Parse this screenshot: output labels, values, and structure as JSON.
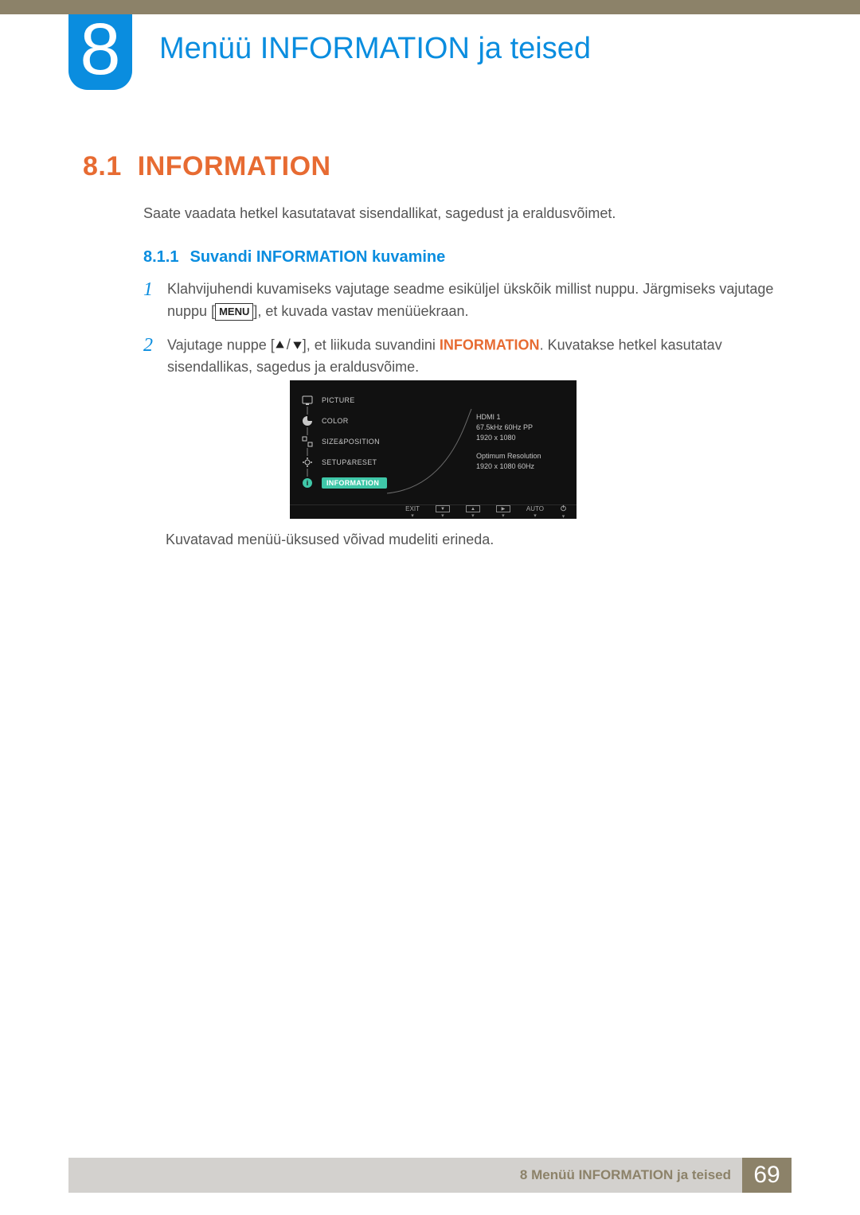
{
  "chapter": {
    "number": "8",
    "title": "Menüü INFORMATION ja teised"
  },
  "section": {
    "number": "8.1",
    "title": "INFORMATION",
    "intro": "Saate vaadata hetkel kasutatavat sisendallikat, sagedust ja eraldusvõimet."
  },
  "subsection": {
    "number": "8.1.1",
    "title": "Suvandi INFORMATION kuvamine"
  },
  "steps": [
    {
      "num": "1",
      "pre": "Klahvijuhendi kuvamiseks vajutage seadme esiküljel ükskõik millist nuppu. Järgmiseks vajutage nuppu [",
      "key": "MENU",
      "post": "], et kuvada vastav menüüekraan."
    },
    {
      "num": "2",
      "pre": "Vajutage nuppe [",
      "mid": "], et liikuda suvandini ",
      "highlight": "INFORMATION",
      "post": ". Kuvatakse hetkel kasutatav sisendallikas, sagedus ja eraldusvõime."
    }
  ],
  "osd": {
    "menu": [
      "PICTURE",
      "COLOR",
      "SIZE&POSITION",
      "SETUP&RESET",
      "INFORMATION"
    ],
    "selected_index": 4,
    "info": {
      "source": "HDMI 1",
      "freq": "67.5kHz 60Hz PP",
      "res": "1920 x 1080",
      "opt_label": "Optimum Resolution",
      "opt_value": "1920 x 1080  60Hz"
    },
    "bottom": {
      "exit": "EXIT",
      "auto": "AUTO"
    }
  },
  "caption": "Kuvatavad menüü-üksused võivad mudeliti erineda.",
  "footer": {
    "text": "8 Menüü INFORMATION ja teised",
    "page": "69"
  },
  "chart_data": null
}
